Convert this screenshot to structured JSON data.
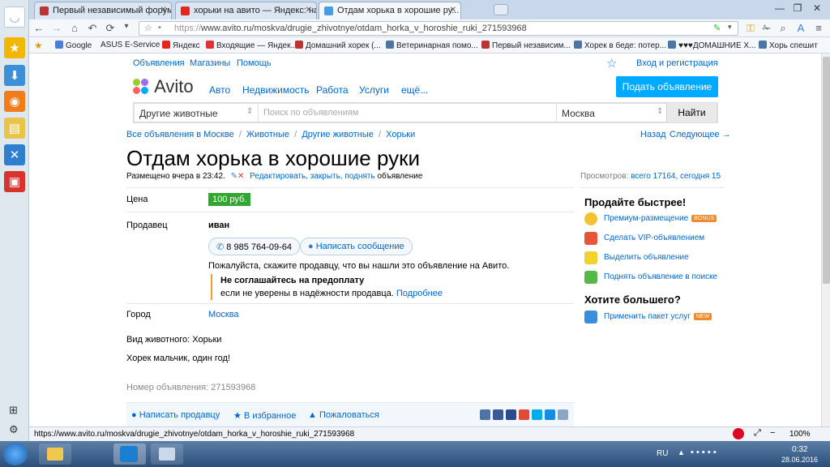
{
  "browser": {
    "tabs": [
      {
        "title": "Первый независимый форум ..."
      },
      {
        "title": "хорьки на авито — Яндекс: на..."
      },
      {
        "title": "Отдам хорька в хорошие ру..."
      }
    ],
    "url_prefix": "https://",
    "url_rest": "www.avito.ru/moskva/drugie_zhivotnye/otdam_horka_v_horoshie_ruki_271593968",
    "bookmarks": [
      {
        "label": "Google"
      },
      {
        "label": "ASUS E-Service"
      },
      {
        "label": "Яндекс"
      },
      {
        "label": "Входящие — Яндек..."
      },
      {
        "label": "Домашний хорек (..."
      },
      {
        "label": "Ветеринарная помо..."
      },
      {
        "label": "Первый независим..."
      },
      {
        "label": "Хорек в беде: потер..."
      },
      {
        "label": "♥♥♥ДОМАШНИЕ Х..."
      },
      {
        "label": "Хорь спешит"
      }
    ],
    "status_url": "https://www.avito.ru/moskva/drugie_zhivotnye/otdam_horka_v_horoshie_ruki_271593968",
    "zoom": "100%"
  },
  "site": {
    "topnav": {
      "ads": "Объявления",
      "shops": "Магазины",
      "help": "Помощь",
      "login": "Вход и регистрация"
    },
    "logo": "Avito",
    "mainnav": [
      "Авто",
      "Недвижимость",
      "Работа",
      "Услуги",
      "ещё..."
    ],
    "post_button": "Подать объявление",
    "search": {
      "category": "Другие животные",
      "placeholder": "Поиск по объявлениям",
      "city": "Москва",
      "button": "Найти"
    },
    "breadcrumbs": [
      "Все объявления в Москве",
      "Животные",
      "Другие животные",
      "Хорьки"
    ],
    "back": "Назад",
    "next": "Следующее →"
  },
  "ad": {
    "title": "Отдам хорька в хорошие руки",
    "posted": "Размещено вчера в 23:42.",
    "edit_links": "Редактировать, закрыть, поднять",
    "edit_suffix": "объявление",
    "views_label": "Просмотров:",
    "views_value": "всего 17164, сегодня 15",
    "price_label": "Цена",
    "price": "100 руб.",
    "seller_label": "Продавец",
    "seller": "иван",
    "phone": "8 985 764-09-64",
    "message_button": "Написать сообщение",
    "tell_seller": "Пожалуйста, скажите продавцу, что вы нашли это объявление на Авито.",
    "warning_bold": "Не соглашайтесь на предоплату",
    "warning_text": "если не уверены в надёжности продавца.",
    "warning_more": "Подробнее",
    "city_label": "Город",
    "city": "Москва",
    "animal_type": "Вид животного: Хорьки",
    "description": "Хорек мальчик, один год!",
    "number": "Номер объявления: 271593968",
    "actions": {
      "write": "Написать продавцу",
      "favorite": "В избранное",
      "complain": "Пожаловаться"
    }
  },
  "sidebar_right": {
    "sell_faster": "Продайте быстрее!",
    "items": [
      {
        "label": "Премиум-размещение",
        "badge": "BONUS"
      },
      {
        "label": "Сделать VIP-объявлением"
      },
      {
        "label": "Выделить объявление"
      },
      {
        "label": "Поднять объявление в поиске"
      }
    ],
    "want_more": "Хотите большего?",
    "package": "Применить пакет услуг",
    "package_badge": "NEW"
  },
  "taskbar": {
    "lang": "RU",
    "time": "0:32",
    "date": "28.06.2016"
  }
}
